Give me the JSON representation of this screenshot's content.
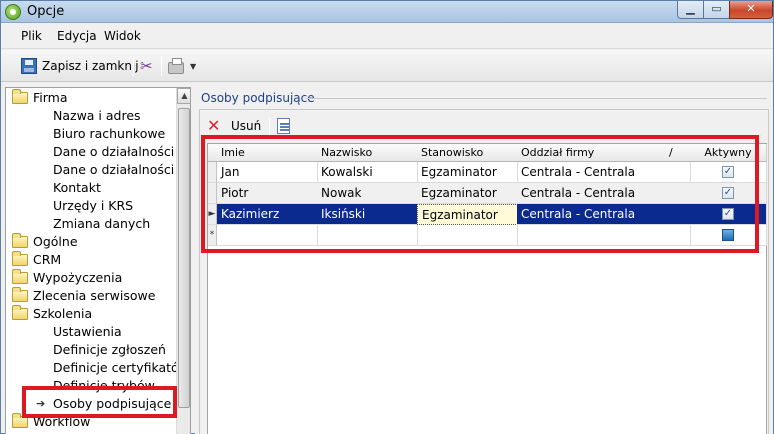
{
  "window": {
    "title": "Opcje"
  },
  "menu": {
    "items": [
      {
        "label": "Plik"
      },
      {
        "label": "Edycja"
      },
      {
        "label": "Widok"
      }
    ]
  },
  "toolbar": {
    "save_label": "Zapisz i zamknij",
    "icons": [
      "save-icon",
      "tools-icon",
      "printer-icon",
      "dropdown-icon"
    ]
  },
  "tree": {
    "items": [
      {
        "label": "Firma",
        "type": "folder"
      },
      {
        "label": "Nazwa i adres",
        "type": "leaf"
      },
      {
        "label": "Biuro rachunkowe",
        "type": "leaf"
      },
      {
        "label": "Dane o działalności",
        "type": "leaf"
      },
      {
        "label": "Dane o działalności",
        "type": "leaf"
      },
      {
        "label": "Kontakt",
        "type": "leaf"
      },
      {
        "label": "Urzędy i KRS",
        "type": "leaf"
      },
      {
        "label": "Zmiana danych",
        "type": "leaf"
      },
      {
        "label": "Ogólne",
        "type": "folder"
      },
      {
        "label": "CRM",
        "type": "folder"
      },
      {
        "label": "Wypożyczenia",
        "type": "folder"
      },
      {
        "label": "Zlecenia serwisowe",
        "type": "folder"
      },
      {
        "label": "Szkolenia",
        "type": "folder"
      },
      {
        "label": "Ustawienia",
        "type": "leaf"
      },
      {
        "label": "Definicje zgłoszeń",
        "type": "leaf"
      },
      {
        "label": "Definicje certyfikatów",
        "type": "leaf"
      },
      {
        "label": "Definicje trybów",
        "type": "leaf"
      },
      {
        "label": "Osoby podpisujące",
        "type": "leaf",
        "selected": true
      },
      {
        "label": "Workflow",
        "type": "folder"
      }
    ]
  },
  "panel": {
    "title": "Osoby podpisujące",
    "delete_label": "Usuń"
  },
  "grid": {
    "columns": [
      {
        "label": "Imie"
      },
      {
        "label": "Nazwisko"
      },
      {
        "label": "Stanowisko"
      },
      {
        "label": "Oddział firmy"
      },
      {
        "label": "Aktywny"
      }
    ],
    "rows": [
      {
        "imie": "Jan",
        "nazwisko": "Kowalski",
        "stanowisko": "Egzaminator",
        "oddzial": "Centrala - Centrala",
        "aktywny": true
      },
      {
        "imie": "Piotr",
        "nazwisko": "Nowak",
        "stanowisko": "Egzaminator",
        "oddzial": "Centrala - Centrala",
        "aktywny": true
      },
      {
        "imie": "Kazimierz",
        "nazwisko": "Iksiński",
        "stanowisko": "Egzaminator",
        "oddzial": "Centrala - Centrala",
        "aktywny": true,
        "selected": true
      }
    ],
    "new_row_marker": "*",
    "current_row_marker": "►",
    "sort_marker": "/",
    "checkmark": "✓"
  },
  "colors": {
    "highlight": "#e01822",
    "selection": "#0a2a8f",
    "panel_title": "#1f3f86"
  }
}
